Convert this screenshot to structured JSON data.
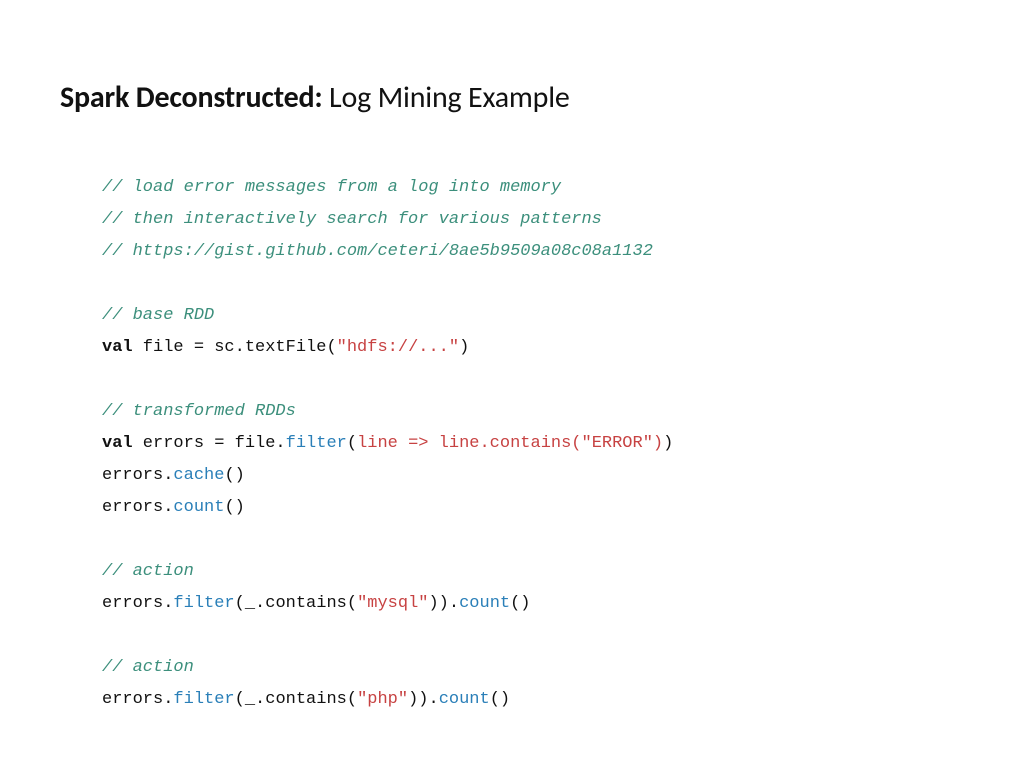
{
  "title": {
    "bold": "Spark Deconstructed:",
    "rest": " Log Mining Example"
  },
  "code": {
    "c1": "// load error messages from a log into memory",
    "c2": "// then interactively search for various patterns",
    "c3": "// https://gist.github.com/ceteri/8ae5b9509a08c08a1132",
    "c4": "// base RDD",
    "l5_kw": "val",
    "l5_a": " file = sc.textFile(",
    "l5_str": "\"hdfs://...\"",
    "l5_b": ")",
    "c6": "// transformed RDDs",
    "l7_kw": "val",
    "l7_a": " errors = file.",
    "l7_fn": "filter",
    "l7_b": "(",
    "l7_lam": "line => line.contains(\"ERROR\")",
    "l7_c": ")",
    "l8_a": "errors.",
    "l8_fn": "cache",
    "l8_b": "()",
    "l9_a": "errors.",
    "l9_fn": "count",
    "l9_b": "()",
    "c10": "// action",
    "l11_a": "errors.",
    "l11_fn1": "filter",
    "l11_b": "(_.contains(",
    "l11_str": "\"mysql\"",
    "l11_c": ")).",
    "l11_fn2": "count",
    "l11_d": "()",
    "c12": "// action",
    "l13_a": "errors.",
    "l13_fn1": "filter",
    "l13_b": "(_.contains(",
    "l13_str": "\"php\"",
    "l13_c": ")).",
    "l13_fn2": "count",
    "l13_d": "()"
  }
}
